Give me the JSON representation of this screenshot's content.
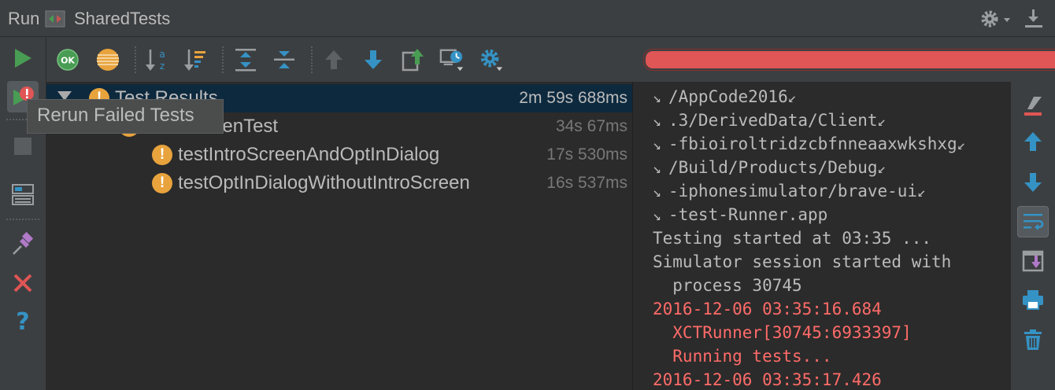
{
  "header": {
    "run_label": "Run",
    "config_name": "SharedTests"
  },
  "tooltip": "Rerun Failed Tests",
  "tree": {
    "rows": [
      {
        "name": "Test Results",
        "time": "2m 59s 688ms"
      },
      {
        "name": "IntroScreenTest",
        "time": "34s 67ms"
      },
      {
        "name": "testIntroScreenAndOptInDialog",
        "time": "17s 530ms"
      },
      {
        "name": "testOptInDialogWithoutIntroScreen",
        "time": "16s 537ms"
      }
    ]
  },
  "console": {
    "lines": [
      {
        "text": "/AppCode2016",
        "wrap_start": true,
        "wrap_end": true
      },
      {
        "text": ".3/DerivedData/Client",
        "wrap_start": true,
        "wrap_end": true
      },
      {
        "text": "-fbioiroltridzcbfnneaaxwkshxg",
        "wrap_start": true,
        "wrap_end": true
      },
      {
        "text": "/Build/Products/Debug",
        "wrap_start": true,
        "wrap_end": true
      },
      {
        "text": "-iphonesimulator/brave-ui",
        "wrap_start": true,
        "wrap_end": true
      },
      {
        "text": "-test-Runner.app",
        "wrap_start": true,
        "wrap_end": false
      },
      {
        "text": "Testing started at 03:35 ..."
      },
      {
        "text": "Simulator session started with"
      },
      {
        "text": "  process 30745"
      },
      {
        "text": "2016-12-06 03:35:16.684",
        "error": true
      },
      {
        "text": "  XCTRunner[30745:6933397]",
        "error": true
      },
      {
        "text": "  Running tests...",
        "error": true
      },
      {
        "text": "2016-12-06 03:35:17.426",
        "error": true
      }
    ]
  },
  "progress": {
    "status": "failed",
    "fraction": 1.0,
    "color": "#e05555"
  },
  "colors": {
    "warning": "#e8a33d",
    "error_text": "#ff6b68",
    "selection": "#0d293e",
    "run_green": "#499c54",
    "accent_blue": "#3592c4"
  },
  "icons": {
    "left_bar": [
      "run-icon",
      "rerun-failed-icon",
      "stop-icon",
      "layout-icon",
      "pin-icon",
      "close-icon",
      "help-icon"
    ],
    "toolbar": [
      "show-passed-icon",
      "show-ignored-icon",
      "sort-alphabetically-icon",
      "sort-by-duration-icon",
      "expand-all-icon",
      "collapse-all-icon",
      "previous-failed-icon",
      "next-failed-icon",
      "export-icon",
      "test-history-icon",
      "settings-icon"
    ],
    "right_bar": [
      "clear-icon",
      "up-icon",
      "down-icon",
      "soft-wrap-icon",
      "scroll-to-end-icon",
      "print-icon",
      "delete-icon"
    ]
  },
  "tree_state": {
    "show_passed_label": "OK"
  }
}
